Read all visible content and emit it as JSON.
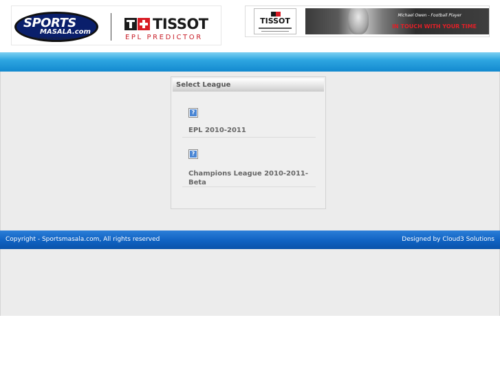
{
  "header": {
    "logo": {
      "sports_word": "SPORTS",
      "masala_word": "MASALA.com",
      "url": "http://www.sportsmasala.com",
      "brand": "TISSOT",
      "subtitle": "EPL PREDICTOR"
    },
    "banner": {
      "brand": "TISSOT",
      "caption": "Michael Owen - Football Player",
      "slogan": "IN TOUCH WITH YOUR TIME"
    }
  },
  "panel": {
    "title": "Select League",
    "leagues": [
      {
        "icon": "broken-image-icon",
        "icon_glyph": "?",
        "name": "EPL 2010-2011"
      },
      {
        "icon": "broken-image-icon",
        "icon_glyph": "?",
        "name": "Champions League 2010-2011-Beta"
      }
    ]
  },
  "footer": {
    "copyright": "Copyright - Sportsmasala.com, All rights reserved",
    "designer": "Designed by Cloud3 Solutions"
  },
  "colors": {
    "top_bar": "#1389cf",
    "footer_bar": "#0f62c2",
    "tissot_red": "#d81b24",
    "background": "#ececec"
  }
}
